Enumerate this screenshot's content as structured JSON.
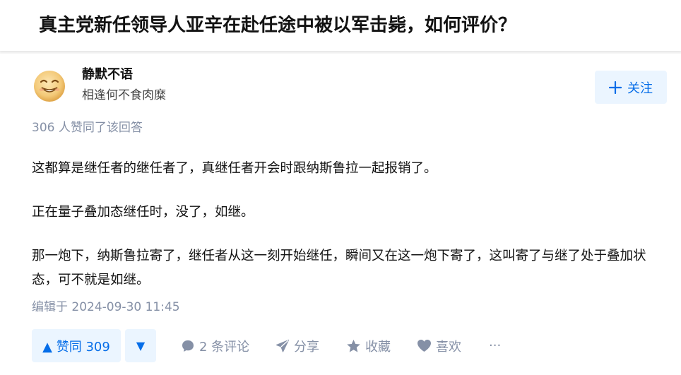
{
  "question": {
    "title": "真主党新任领导人亚辛在赴任途中被以军击毙，如何评价？"
  },
  "author": {
    "name": "静默不语",
    "bio": "相逢何不食肉糜",
    "follow_label": "关注"
  },
  "answer": {
    "vote_summary": "306 人赞同了该回答",
    "paragraphs": [
      "这都算是继任者的继任者了，真继任者开会时跟纳斯鲁拉一起报销了。",
      "正在量子叠加态继任时，没了，如继。",
      "那一炮下，纳斯鲁拉寄了，继任者从这一刻开始继任，瞬间又在这一炮下寄了，这叫寄了与继了处于叠加状态，可不就是如继。"
    ],
    "edit_time": "编辑于 2024-09-30 11:45"
  },
  "actions": {
    "upvote_label": "▲ 赞同 309",
    "downvote_label": "▼",
    "comment_label": "2 条评论",
    "share_label": "分享",
    "collect_label": "收藏",
    "like_label": "喜欢",
    "more_label": "···"
  },
  "colors": {
    "brand_blue": "#056de8",
    "button_bg": "#ebf5ff",
    "muted_gray": "#8590a6"
  },
  "icons": [
    "avatar-face",
    "plus-icon",
    "comment-icon",
    "share-icon",
    "star-icon",
    "heart-icon",
    "more-icon"
  ]
}
